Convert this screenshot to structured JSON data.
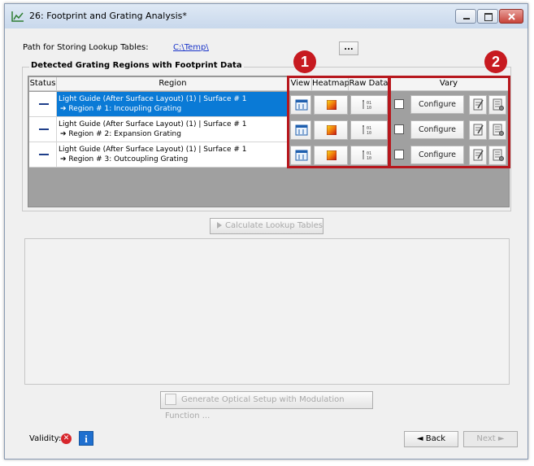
{
  "window": {
    "title": "26: Footprint and Grating Analysis*"
  },
  "path": {
    "label": "Path for Storing Lookup Tables:",
    "value": "C:\\Temp\\",
    "browse_label": "..."
  },
  "group": {
    "label": "Detected Grating Regions with Footprint Data"
  },
  "table": {
    "headers": {
      "status": "Status",
      "region": "Region",
      "view": "View",
      "heatmap": "Heatmap",
      "raw_data": "Raw Data",
      "vary": "Vary"
    },
    "rows": [
      {
        "line1": "Light Guide (After Surface Layout) (1) | Surface # 1",
        "line2": "➔ Region # 1: Incoupling Grating",
        "configure": "Configure",
        "selected": true
      },
      {
        "line1": "Light Guide (After Surface Layout) (1) | Surface # 1",
        "line2": "➔ Region # 2: Expansion Grating",
        "configure": "Configure",
        "selected": false
      },
      {
        "line1": "Light Guide (After Surface Layout) (1) | Surface # 1",
        "line2": "➔ Region # 3: Outcoupling Grating",
        "configure": "Configure",
        "selected": false
      }
    ]
  },
  "annotations": {
    "badge1": "1",
    "badge2": "2"
  },
  "buttons": {
    "calculate": "Calculate Lookup Tables",
    "generate": "Generate Optical Setup with Modulation Function ...",
    "back": "◄ Back",
    "next": "Next ►"
  },
  "footer": {
    "validity_label": "Validity:"
  },
  "colors": {
    "selection": "#0a7ad6",
    "annotation_red": "#b7171d",
    "link": "#1a35c9"
  }
}
